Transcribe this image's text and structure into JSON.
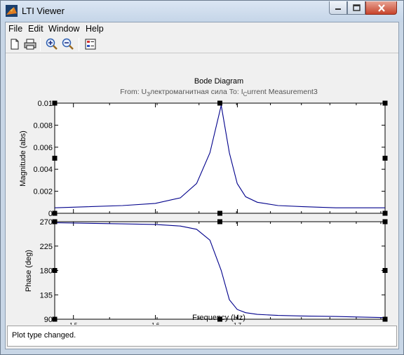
{
  "window": {
    "title": "LTI Viewer",
    "accent_close": "#c7442c"
  },
  "menu": [
    "File",
    "Edit",
    "Window",
    "Help"
  ],
  "toolbar": {
    "icons": [
      "new-icon",
      "print-icon",
      "zoom-in-icon",
      "zoom-out-icon",
      "grid-legend-icon"
    ]
  },
  "plot": {
    "title": "Bode Diagram",
    "subtitle_from_label": "From:",
    "subtitle_from_main": "U",
    "subtitle_from_sub": "З",
    "subtitle_from_rest": "лектромагнитная сила",
    "subtitle_to_label": "To:",
    "subtitle_to_main": "I",
    "subtitle_to_sub": "C",
    "subtitle_to_rest": "urrent Measurement3",
    "mag_ylabel": "Magnitude (abs)",
    "phase_ylabel": "Phase (deg)",
    "xlabel": "Frequency  (Hz)",
    "line_color": "#00008b"
  },
  "chart_data": [
    {
      "type": "line",
      "name": "magnitude",
      "x": [
        30,
        36.3,
        39.8,
        42.7,
        44.7,
        46.4,
        47.9,
        49.0,
        50.1,
        51.3,
        53.0,
        56.2,
        60.3,
        66.1,
        75.9
      ],
      "y": [
        0.0005,
        0.0007,
        0.0009,
        0.0014,
        0.0027,
        0.0055,
        0.0098,
        0.0055,
        0.0027,
        0.0015,
        0.001,
        0.0007,
        0.0006,
        0.0005,
        0.0005
      ],
      "ylim": [
        0,
        0.01
      ],
      "xlim": [
        30,
        75.9
      ],
      "xscale": "log",
      "yticks": [
        "0",
        "0.002",
        "0.004",
        "0.006",
        "0.008",
        "0.01"
      ],
      "ytick_values": [
        0,
        0.002,
        0.004,
        0.006,
        0.008,
        0.01
      ]
    },
    {
      "type": "line",
      "name": "phase",
      "x": [
        30,
        36.3,
        39.8,
        42.7,
        44.7,
        46.4,
        47.9,
        49.0,
        50.1,
        51.3,
        53.0,
        56.2,
        60.3,
        66.1,
        75.9
      ],
      "y": [
        268,
        266,
        265,
        262,
        256,
        236,
        180,
        126,
        108,
        102,
        99,
        97,
        96,
        95,
        93
      ],
      "ylim": [
        90,
        270
      ],
      "xlim": [
        30,
        75.9
      ],
      "xscale": "log",
      "yticks": [
        "90",
        "135",
        "180",
        "225",
        "270"
      ],
      "ytick_values": [
        90,
        135,
        180,
        225,
        270
      ],
      "xticks": [
        {
          "base": "10",
          "exp": "1.5",
          "value": 31.62
        },
        {
          "base": "10",
          "exp": "1.6",
          "value": 39.81
        },
        {
          "base": "10",
          "exp": "1.7",
          "value": 50.12
        }
      ]
    }
  ],
  "status": {
    "text": "Plot type changed."
  }
}
